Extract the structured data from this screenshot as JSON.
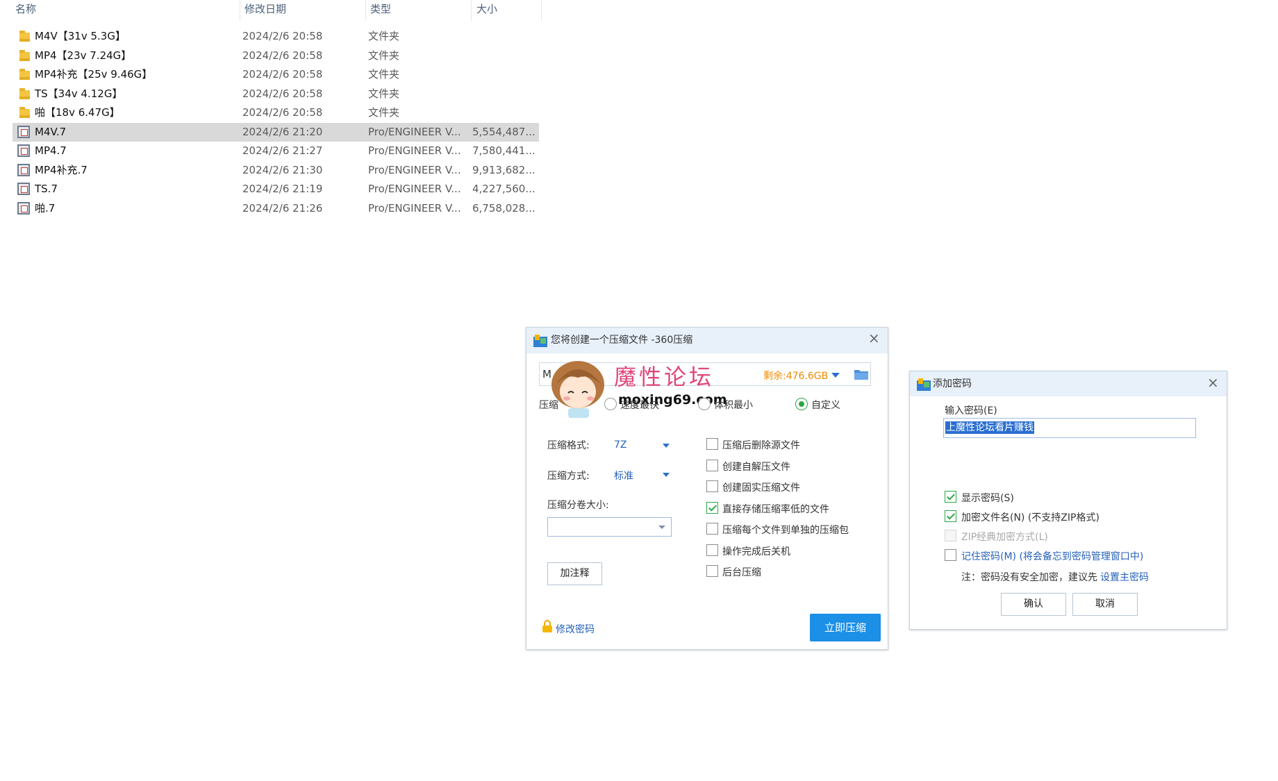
{
  "file_list": {
    "columns": {
      "name": "名称",
      "date": "修改日期",
      "type": "类型",
      "size": "大小"
    },
    "rows": [
      {
        "name": "M4V【31v 5.3G】",
        "date": "2024/2/6 20:58",
        "type": "文件夹",
        "size": "",
        "icon": "folder-icon"
      },
      {
        "name": "MP4【23v 7.24G】",
        "date": "2024/2/6 20:58",
        "type": "文件夹",
        "size": "",
        "icon": "folder-icon"
      },
      {
        "name": "MP4补充【25v 9.46G】",
        "date": "2024/2/6 20:58",
        "type": "文件夹",
        "size": "",
        "icon": "folder-icon"
      },
      {
        "name": "TS【34v 4.12G】",
        "date": "2024/2/6 20:58",
        "type": "文件夹",
        "size": "",
        "icon": "folder-icon"
      },
      {
        "name": "啪【18v 6.47G】",
        "date": "2024/2/6 20:58",
        "type": "文件夹",
        "size": "",
        "icon": "folder-icon"
      },
      {
        "name": "M4V.7",
        "date": "2024/2/6 21:20",
        "type": "Pro/ENGINEER V...",
        "size": "5,554,487...",
        "icon": "archive-file-icon",
        "selected": true
      },
      {
        "name": "MP4.7",
        "date": "2024/2/6 21:27",
        "type": "Pro/ENGINEER V...",
        "size": "7,580,441...",
        "icon": "archive-file-icon"
      },
      {
        "name": "MP4补充.7",
        "date": "2024/2/6 21:30",
        "type": "Pro/ENGINEER V...",
        "size": "9,913,682...",
        "icon": "archive-file-icon"
      },
      {
        "name": "TS.7",
        "date": "2024/2/6 21:19",
        "type": "Pro/ENGINEER V...",
        "size": "4,227,560...",
        "icon": "archive-file-icon"
      },
      {
        "name": "啪.7",
        "date": "2024/2/6 21:26",
        "type": "Pro/ENGINEER V...",
        "size": "6,758,028...",
        "icon": "archive-file-icon"
      }
    ]
  },
  "compress_dialog": {
    "title": "您将创建一个压缩文件 -360压缩",
    "path_prefix": "M",
    "free_space": "剩余:476.6GB",
    "mode_label": "压缩",
    "mode_options": [
      "速度最快",
      "体积最小",
      "自定义"
    ],
    "format_label": "压缩格式:",
    "format_value": "7Z",
    "method_label": "压缩方式:",
    "method_value": "标准",
    "split_label": "压缩分卷大小:",
    "comment_button": "加注释",
    "options": [
      {
        "label": "压缩后删除源文件",
        "checked": false
      },
      {
        "label": "创建自解压文件",
        "checked": false
      },
      {
        "label": "创建固实压缩文件",
        "checked": false
      },
      {
        "label": "直接存储压缩率低的文件",
        "checked": true
      },
      {
        "label": "压缩每个文件到单独的压缩包",
        "checked": false
      },
      {
        "label": "操作完成后关机",
        "checked": false
      },
      {
        "label": "后台压缩",
        "checked": false
      }
    ],
    "change_password_link": "修改密码",
    "compress_button": "立即压缩"
  },
  "watermark": {
    "title": "魔性论坛",
    "url": "moxing69.com"
  },
  "password_dialog": {
    "title": "添加密码",
    "input_label": "输入密码(E)",
    "password_value": "上魔性论坛看片赚钱",
    "options": [
      {
        "label": "显示密码(S)",
        "checked": true,
        "disabled": false
      },
      {
        "label": "加密文件名(N) (不支持ZIP格式)",
        "checked": true,
        "disabled": false
      },
      {
        "label": "ZIP经典加密方式(L)",
        "checked": false,
        "disabled": true
      }
    ],
    "remember_link": "记住密码(M) (将会备忘到密码管理窗口中)",
    "note_text": "注：密码没有安全加密，建议先",
    "note_link": "设置主密码",
    "ok_button": "确认",
    "cancel_button": "取消"
  },
  "colors": {
    "accent": "#1c8fe6",
    "check": "#28a745",
    "free_space": "#f08a00",
    "link": "#2461b8"
  }
}
